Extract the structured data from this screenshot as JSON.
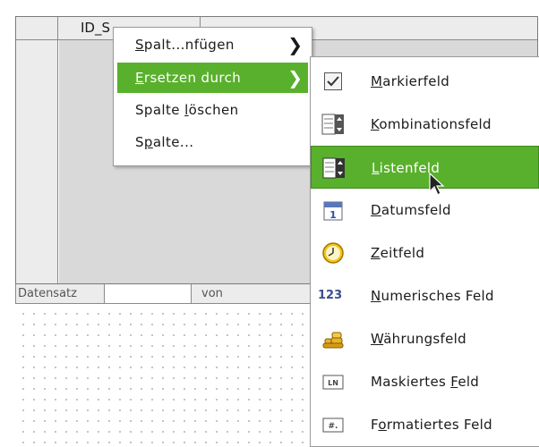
{
  "grid": {
    "column_header": "ID_S",
    "record_label": "Datensatz",
    "record_of": "von"
  },
  "context_menu": {
    "items": [
      {
        "pre": "",
        "ul": "S",
        "post": "palt...nfügen",
        "has_submenu": true
      },
      {
        "pre": "",
        "ul": "E",
        "post": "rsetzen durch",
        "has_submenu": true,
        "selected": true
      },
      {
        "pre": "Spalte ",
        "ul": "l",
        "post": "öschen"
      },
      {
        "pre": "S",
        "ul": "p",
        "post": "alte..."
      }
    ]
  },
  "submenu": {
    "items": [
      {
        "icon": "checkbox-icon",
        "pre": "",
        "ul": "M",
        "post": "arkierfeld"
      },
      {
        "icon": "combobox-icon",
        "pre": "",
        "ul": "K",
        "post": "ombinationsfeld"
      },
      {
        "icon": "listbox-icon",
        "pre": "",
        "ul": "L",
        "post": "istenfeld",
        "selected": true
      },
      {
        "icon": "calendar-icon",
        "pre": "",
        "ul": "D",
        "post": "atumsfeld"
      },
      {
        "icon": "clock-icon",
        "pre": "",
        "ul": "Z",
        "post": "eitfeld"
      },
      {
        "icon": "numeric-icon",
        "icon_text": "123",
        "pre": "",
        "ul": "N",
        "post": "umerisches Feld"
      },
      {
        "icon": "coins-icon",
        "pre": "",
        "ul": "W",
        "post": "ährungsfeld"
      },
      {
        "icon": "masked-field-icon",
        "icon_text": "LN",
        "pre": "Maskiertes ",
        "ul": "F",
        "post": "eld"
      },
      {
        "icon": "formatted-field-icon",
        "icon_text": "#.",
        "pre": "F",
        "ul": "o",
        "post": "rmatiertes Feld"
      }
    ]
  },
  "colors": {
    "highlight": "#59b02c",
    "grid_background": "#d9d9d9"
  }
}
